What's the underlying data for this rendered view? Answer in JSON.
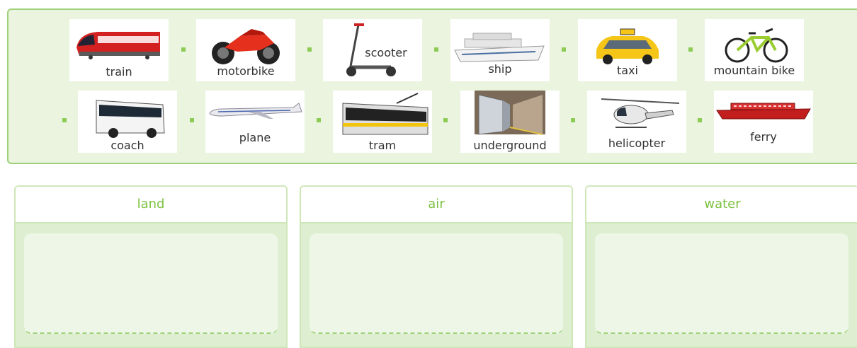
{
  "items": [
    {
      "label": "train",
      "icon": "train-icon"
    },
    {
      "label": "motorbike",
      "icon": "motorbike-icon"
    },
    {
      "label": "scooter",
      "icon": "scooter-icon"
    },
    {
      "label": "ship",
      "icon": "ship-icon"
    },
    {
      "label": "taxi",
      "icon": "taxi-icon"
    },
    {
      "label": "mountain bike",
      "icon": "mountain-bike-icon"
    },
    {
      "label": "coach",
      "icon": "coach-icon"
    },
    {
      "label": "plane",
      "icon": "plane-icon"
    },
    {
      "label": "tram",
      "icon": "tram-icon"
    },
    {
      "label": "underground",
      "icon": "underground-icon"
    },
    {
      "label": "helicopter",
      "icon": "helicopter-icon"
    },
    {
      "label": "ferry",
      "icon": "ferry-icon"
    }
  ],
  "categories": [
    {
      "label": "land"
    },
    {
      "label": "air"
    },
    {
      "label": "water"
    }
  ],
  "colors": {
    "accent": "#7cc242",
    "pool_bg": "#eaf4df",
    "box_bg": "#ddefd0"
  }
}
